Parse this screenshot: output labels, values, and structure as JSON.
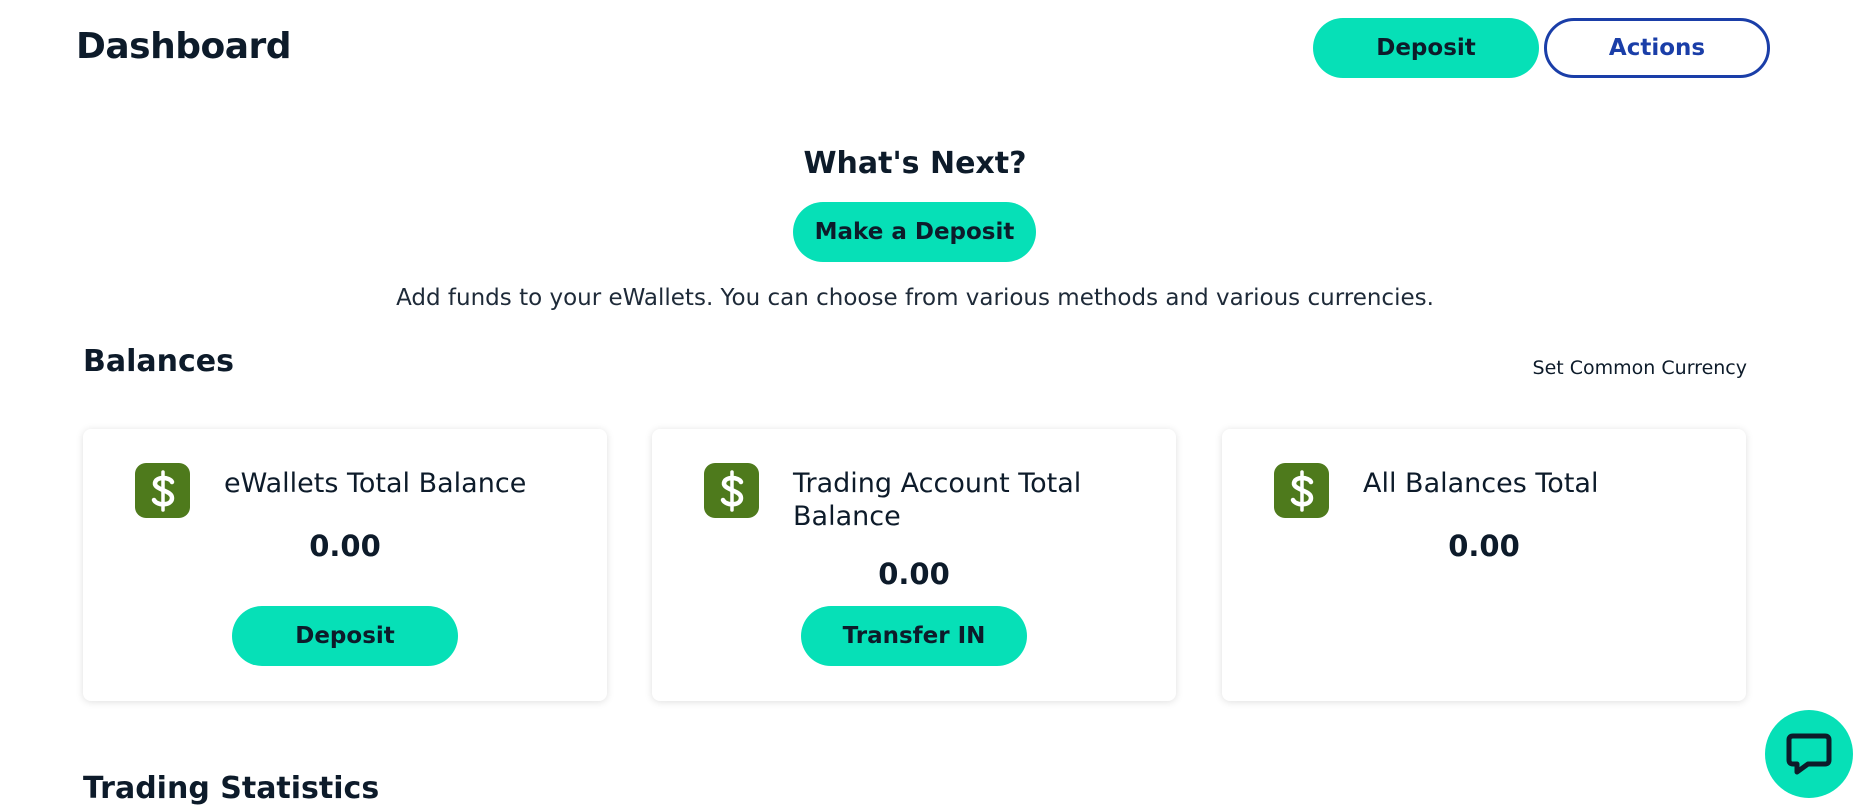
{
  "header": {
    "title": "Dashboard",
    "deposit_label": "Deposit",
    "actions_label": "Actions"
  },
  "whats_next": {
    "title": "What's Next?",
    "button_label": "Make a Deposit",
    "description": "Add funds to your eWallets. You can choose from various methods and various currencies."
  },
  "balances": {
    "title": "Balances",
    "set_currency_label": "Set Common Currency",
    "cards": [
      {
        "icon": "dollar-icon",
        "label": "eWallets Total Balance",
        "value": "0.00",
        "button_label": "Deposit"
      },
      {
        "icon": "dollar-icon",
        "label": "Trading Account Total Balance",
        "value": "0.00",
        "button_label": "Transfer IN"
      },
      {
        "icon": "dollar-icon",
        "label": "All Balances Total",
        "value": "0.00"
      }
    ]
  },
  "trading_statistics": {
    "title": "Trading Statistics"
  },
  "chat": {
    "icon": "chat-icon"
  },
  "colors": {
    "accent": "#06e0b7",
    "outline_blue": "#1a3ea8",
    "icon_green": "#4e7a1c",
    "text_dark": "#0d1b2a"
  }
}
